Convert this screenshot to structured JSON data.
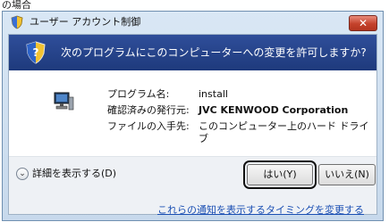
{
  "page": {
    "caption": "の場合"
  },
  "window": {
    "title": "ユーザー アカウント制御",
    "close_label": "✕"
  },
  "header": {
    "prompt": "次のプログラムにこのコンピューターへの変更を許可しますか?"
  },
  "program_info": {
    "name_label": "プログラム名:",
    "name_value": "install",
    "publisher_label": "確認済みの発行元:",
    "publisher_value": "JVC KENWOOD Corporation",
    "origin_label": "ファイルの入手先:",
    "origin_value": "このコンピューター上のハード ドライブ"
  },
  "details": {
    "toggle_label": "詳細を表示する(D)",
    "expand_icon": "chevron-down-icon"
  },
  "buttons": {
    "yes_label": "はい(Y)",
    "no_label": "いいえ(N)"
  },
  "footer": {
    "link_label": "これらの通知を表示するタイミングを変更する"
  },
  "colors": {
    "header_band": "#1e3a7c",
    "close_button": "#c4422b",
    "link": "#1a4fb3"
  }
}
